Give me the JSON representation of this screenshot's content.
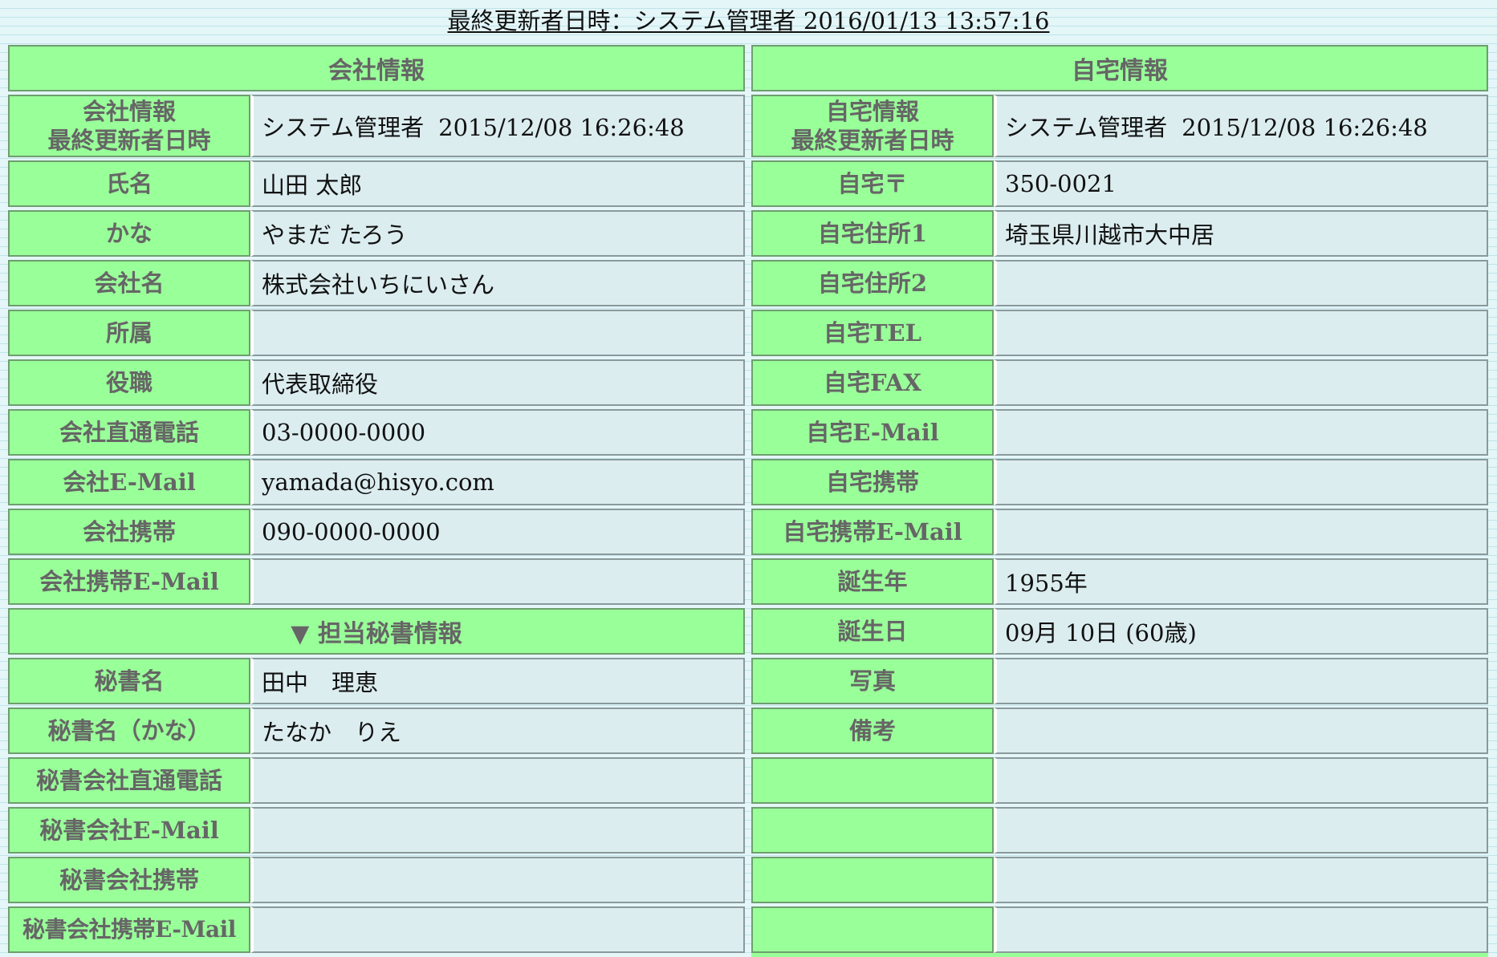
{
  "header": {
    "last_updated": "最終更新者日時：システム管理者 2016/01/13 13:57:16"
  },
  "company": {
    "section_title": "会社情報",
    "updated_label": [
      "会社情報",
      "最終更新者日時"
    ],
    "updated_by": "システム管理者",
    "updated_at": "2015/12/08 16:26:48",
    "rows": [
      {
        "label": "氏名",
        "value": "山田 太郎"
      },
      {
        "label": "かな",
        "value": "やまだ たろう"
      },
      {
        "label": "会社名",
        "value": "株式会社いちにいさん"
      },
      {
        "label": "所属",
        "value": ""
      },
      {
        "label": "役職",
        "value": "代表取締役"
      },
      {
        "label": "会社直通電話",
        "value": "03-0000-0000"
      },
      {
        "label": "会社E-Mail",
        "value": "yamada@hisyo.com"
      },
      {
        "label": "会社携帯",
        "value": "090-0000-0000"
      },
      {
        "label": "会社携帯E-Mail",
        "value": ""
      }
    ]
  },
  "secretary": {
    "section_title": "▼ 担当秘書情報",
    "rows": [
      {
        "label": "秘書名",
        "value": "田中　理恵"
      },
      {
        "label": "秘書名（かな）",
        "value": "たなか　りえ"
      },
      {
        "label": "秘書会社直通電話",
        "value": ""
      },
      {
        "label": "秘書会社E-Mail",
        "value": ""
      },
      {
        "label": "秘書会社携帯",
        "value": ""
      },
      {
        "label": "秘書会社携帯E-Mail",
        "value": ""
      }
    ]
  },
  "home": {
    "section_title": "自宅情報",
    "updated_label": [
      "自宅情報",
      "最終更新者日時"
    ],
    "updated_by": "システム管理者",
    "updated_at": "2015/12/08 16:26:48",
    "rows": [
      {
        "label": "自宅〒",
        "value": "350-0021"
      },
      {
        "label": "自宅住所1",
        "value": "埼玉県川越市大中居"
      },
      {
        "label": "自宅住所2",
        "value": ""
      },
      {
        "label": "自宅TEL",
        "value": ""
      },
      {
        "label": "自宅FAX",
        "value": ""
      },
      {
        "label": "自宅E-Mail",
        "value": ""
      },
      {
        "label": "自宅携帯",
        "value": ""
      },
      {
        "label": "自宅携帯E-Mail",
        "value": ""
      },
      {
        "label": "誕生年",
        "value": "1955年"
      },
      {
        "label": "誕生日",
        "value": "09月 10日 (60歳)"
      },
      {
        "label": "写真",
        "value": ""
      },
      {
        "label": "備考",
        "value": ""
      },
      {
        "label": "",
        "value": ""
      },
      {
        "label": "",
        "value": ""
      },
      {
        "label": "",
        "value": ""
      },
      {
        "label": "",
        "value": ""
      }
    ]
  }
}
